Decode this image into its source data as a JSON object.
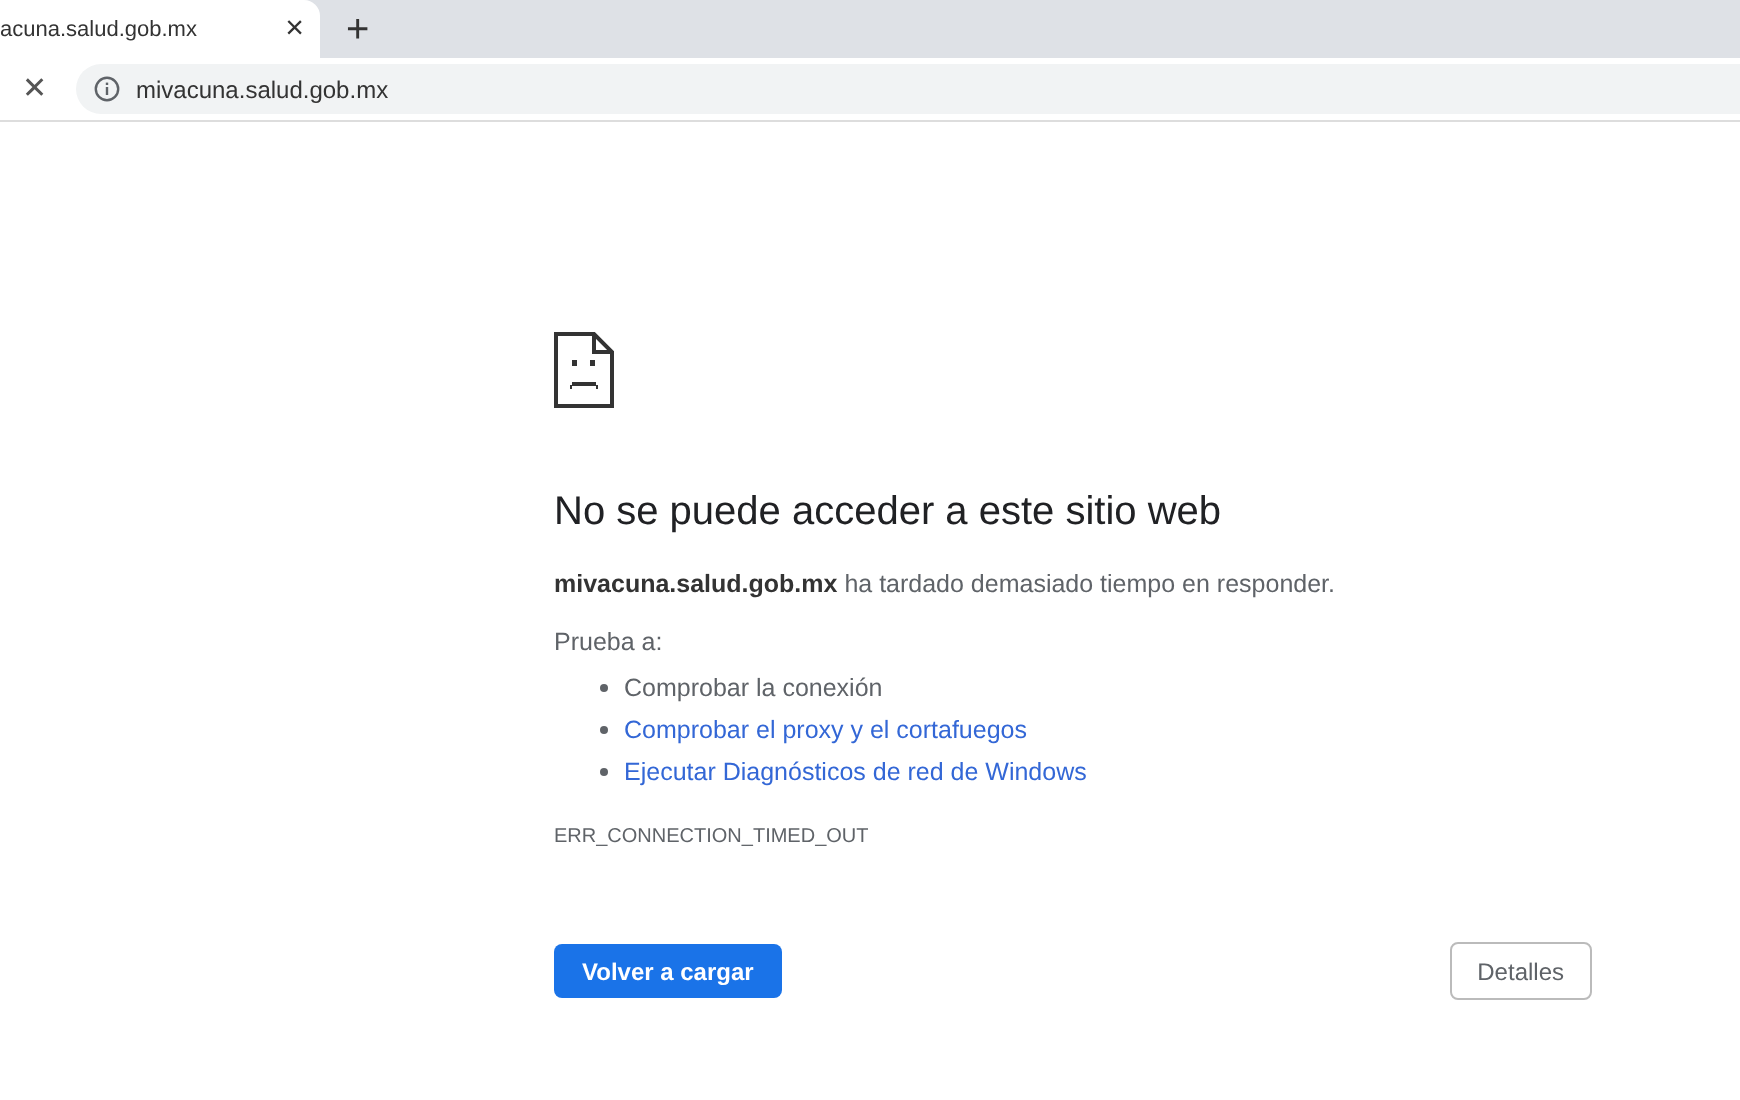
{
  "tab": {
    "title": "acuna.salud.gob.mx",
    "close": "×",
    "new_tab": "+"
  },
  "toolbar": {
    "stop": "✕",
    "url": "mivacuna.salud.gob.mx"
  },
  "error": {
    "heading": "No se puede acceder a este sitio web",
    "message": "**mivacuna.salud.gob.mx** ha tardado demasiado tiempo en responder.",
    "try_label": "Prueba a:",
    "suggestions": [
      {
        "text": "Comprobar la conexión",
        "kind": "text"
      },
      {
        "text": "Comprobar el proxy y el cortafuegos",
        "kind": "link"
      },
      {
        "text": "Ejecutar Diagnósticos de red de Windows",
        "kind": "link"
      }
    ],
    "code": "ERR_CONNECTION_TIMED_OUT"
  },
  "buttons": {
    "reload": "Volver a cargar",
    "details": "Detalles"
  }
}
